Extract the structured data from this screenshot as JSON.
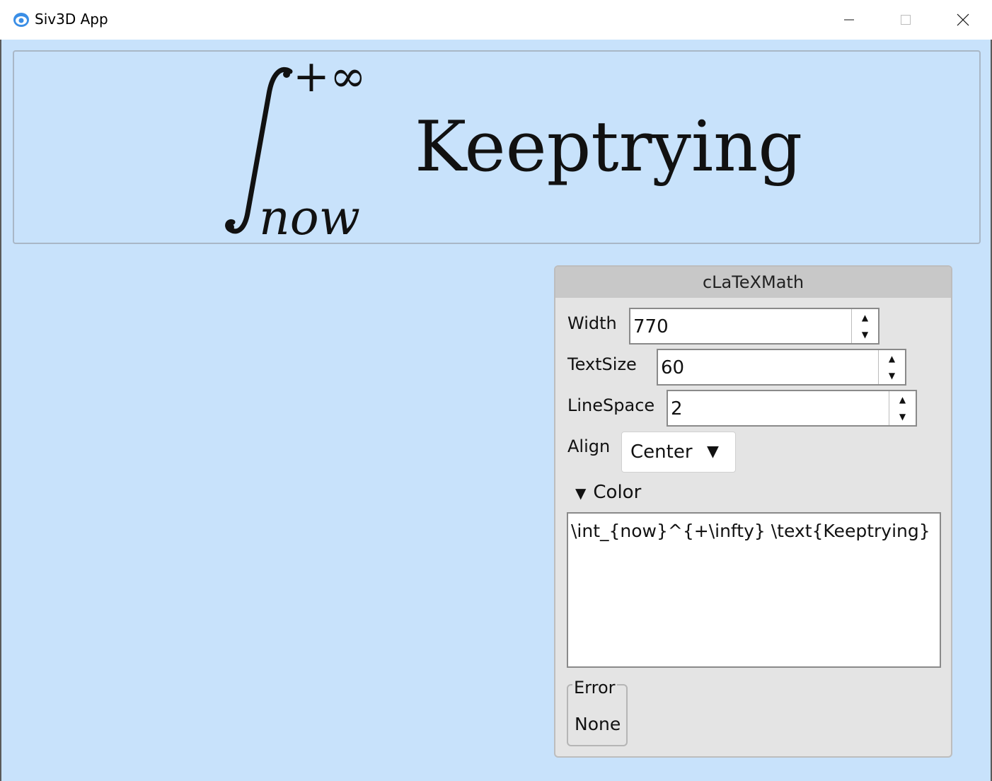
{
  "window": {
    "title": "Siv3D App",
    "controls": {
      "minimize": "minimize",
      "maximize": "maximize",
      "close": "close"
    }
  },
  "formula": {
    "integral_upper": "+∞",
    "integral_lower": "now",
    "text": "Keeptrying"
  },
  "panel": {
    "title": "cLaTeXMath",
    "width": {
      "label": "Width",
      "value": "770"
    },
    "text_size": {
      "label": "TextSize",
      "value": "60"
    },
    "line_space": {
      "label": "LineSpace",
      "value": "2"
    },
    "align": {
      "label": "Align",
      "value": "Center",
      "caret": "▼"
    },
    "color": {
      "toggle_icon": "▼",
      "label": "Color"
    },
    "source": "\\int_{now}^{+\\infty} \\text{Keeptrying}",
    "error": {
      "label": "Error",
      "value": "None"
    }
  },
  "colors": {
    "background": "#c8e2fb",
    "panel": "#e4e4e4",
    "panel_header": "#c8c8c8"
  }
}
